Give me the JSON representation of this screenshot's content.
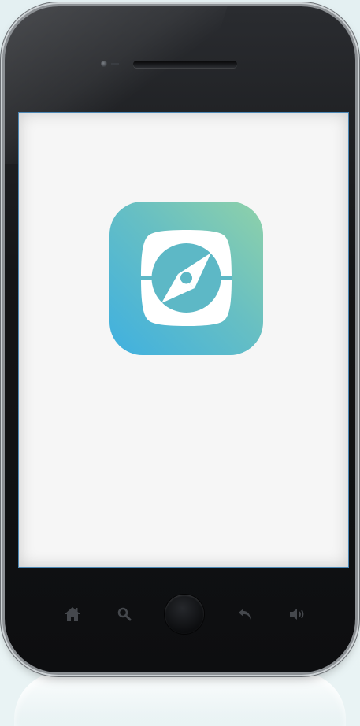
{
  "device": {
    "type": "smartphone",
    "screen_state": "app-splash",
    "frame_color": "#141517",
    "screen_background": "#f6f6f6"
  },
  "app": {
    "icon": "compass-icon",
    "icon_gradient": [
      "#8fd1a9",
      "#3fb0e0"
    ]
  },
  "bottom_bar": {
    "buttons": [
      {
        "name": "home-icon"
      },
      {
        "name": "search-icon"
      },
      {
        "name": "home-button"
      },
      {
        "name": "back-icon"
      },
      {
        "name": "volume-icon"
      }
    ]
  }
}
